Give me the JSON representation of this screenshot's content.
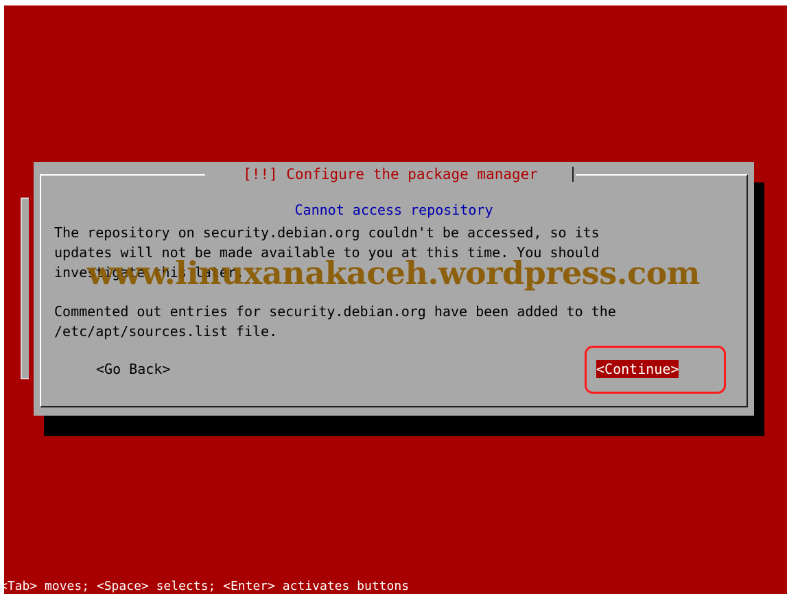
{
  "dialog": {
    "title": "[!!] Configure the package manager",
    "subtitle": "Cannot access repository",
    "paragraph1": "The repository on security.debian.org couldn't be accessed, so its\nupdates will not be made available to you at this time. You should\ninvestigate this later.",
    "paragraph2": "Commented out entries for security.debian.org have been added to the\n/etc/apt/sources.list file.",
    "buttons": {
      "go_back": "<Go Back>",
      "continue": "<Continue>"
    }
  },
  "watermark": "www.linuxanakaceh.wordpress.com",
  "help_line": "<Tab> moves; <Space> selects; <Enter> activates buttons",
  "colors": {
    "background": "#a80000",
    "dialog": "#a8a8a8",
    "title": "#b00000",
    "subtitle": "#0000b0",
    "highlight": "#ff1a1a",
    "watermark": "#8a5a00"
  }
}
